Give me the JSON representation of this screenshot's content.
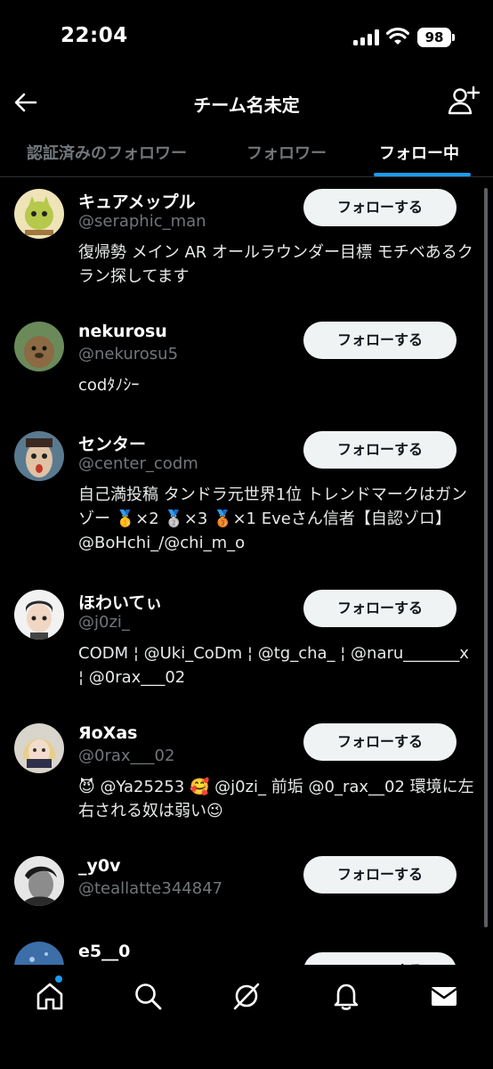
{
  "status_bar": {
    "time": "22:04",
    "battery": "98"
  },
  "header": {
    "title": "チーム名未定",
    "back_icon": "arrow-left-icon",
    "add_icon": "person-add-icon"
  },
  "tabs": [
    {
      "label": "認証済みのフォロワー",
      "active": false
    },
    {
      "label": "フォロワー",
      "active": false
    },
    {
      "label": "フォロー中",
      "active": true
    }
  ],
  "users": [
    {
      "name": "キュアメップル",
      "handle": "@seraphic_man",
      "bio": "復帰勢 メイン AR オールラウンダー目標 モチベあるクラン探してます",
      "button": "フォローする"
    },
    {
      "name": "nekurosu",
      "handle": "@nekurosu5",
      "bio": "codﾀﾉｼｰ",
      "button": "フォローする"
    },
    {
      "name": "センター",
      "handle": "@center_codm",
      "bio": "自己満投稿 タンドラ元世界1位 トレンドマークはガンゾー 🥇×2 🥈×3 🥉×1 Eveさん信者【自認ゾロ】@BoHchi_/@chi_m_o",
      "button": "フォローする"
    },
    {
      "name": "ほわいてぃ",
      "handle": "@j0zi_",
      "bio": "CODM ¦ @Uki_CoDm ¦ @tg_cha_ ¦ @naru_______x ¦ @0rax___02",
      "button": "フォローする"
    },
    {
      "name": "ЯoXas",
      "handle": "@0rax___02",
      "bio": "😈 @Ya25253 🥰 @j0zi_ 前垢 @0_rax__02 環境に左右される奴は弱い😉",
      "button": "フォローする"
    },
    {
      "name": "_y0v",
      "handle": "@teallatte344847",
      "bio": "",
      "button": "フォローする"
    },
    {
      "name": "e5__0",
      "handle": "",
      "bio": "",
      "button": "フォローする"
    }
  ],
  "bottom_nav": [
    "home-icon",
    "search-icon",
    "grok-icon",
    "bell-icon",
    "mail-icon"
  ],
  "colors": {
    "accent": "#1d9bf0",
    "background": "#000000",
    "secondary_text": "#71767b",
    "button_bg": "#eff3f4"
  }
}
